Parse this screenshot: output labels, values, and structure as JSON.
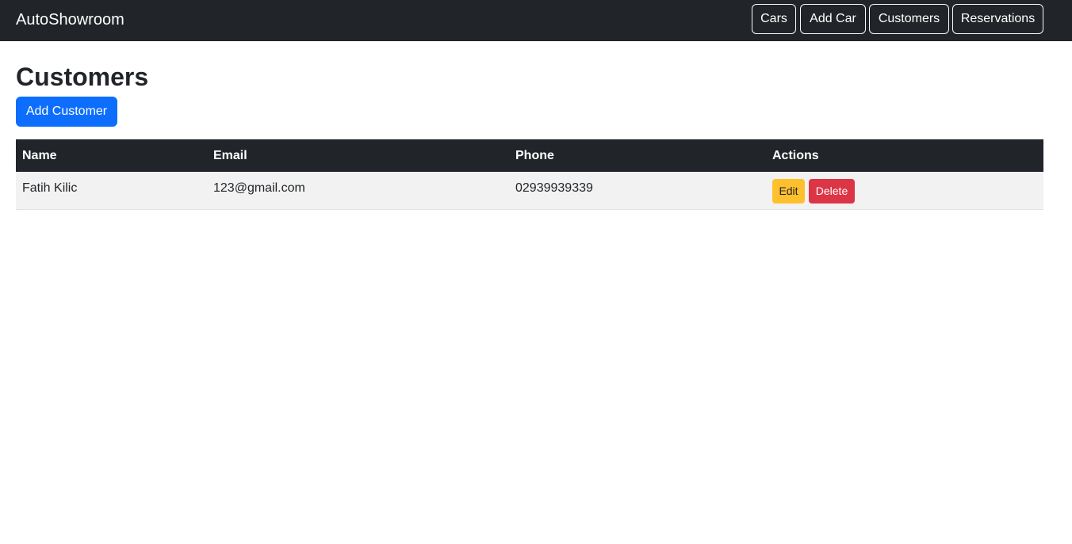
{
  "navbar": {
    "brand": "AutoShowroom",
    "links": [
      "Cars",
      "Add Car",
      "Customers",
      "Reservations"
    ]
  },
  "page": {
    "title": "Customers",
    "add_button": "Add Customer"
  },
  "table": {
    "headers": [
      "Name",
      "Email",
      "Phone",
      "Actions"
    ],
    "rows": [
      {
        "name": "Fatih Kilic",
        "email": "123@gmail.com",
        "phone": "02939939339",
        "edit_label": "Edit",
        "delete_label": "Delete"
      }
    ]
  },
  "colors": {
    "navbar_bg": "#212529",
    "primary": "#0d6efd",
    "warning": "#ffc02e",
    "danger": "#dc3545",
    "row_bg": "#f2f2f2"
  }
}
